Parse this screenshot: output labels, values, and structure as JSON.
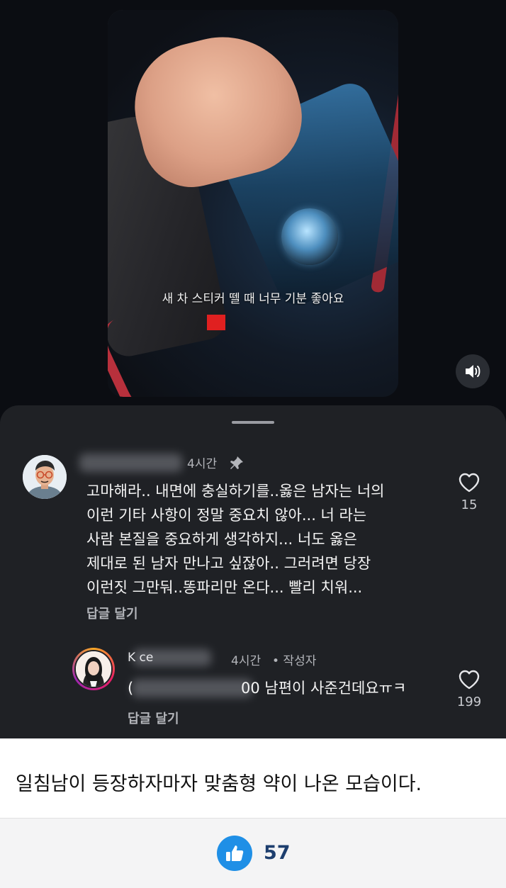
{
  "video": {
    "caption": "새 차 스티커 뗄 때 너무 기분 좋아요"
  },
  "comments": [
    {
      "author": "",
      "time": "4시간",
      "pinned": true,
      "text_lines": [
        "고마해라.. 내면에 충실하기를..옳은 남자는 너의",
        "이런 기타 사항이  정말 중요치 않아... 너 라는",
        "사람 본질을 중요하게 생각하지... 너도 옳은",
        "제대로 된 남자 만나고 싶잖아.. 그러려면 당장",
        "이런짓 그만둬..똥파리만 온다... 빨리 치워..."
      ],
      "reply_label": "답글 달기",
      "likes": "15"
    },
    {
      "author": "K          ce",
      "time": "4시간",
      "author_badge": "• 작성자",
      "text_prefix": "(",
      "text": "00 남편이 사준건데요ㅠㅋ",
      "reply_label": "답글 달기",
      "likes": "199"
    }
  ],
  "post": {
    "caption": "일침남이 등장하자마자 맞춤형 약이 나온 모습이다."
  },
  "footer": {
    "like_count": "57"
  },
  "colors": {
    "sheet_bg": "#1f2125",
    "like_button": "#1f8fe6",
    "count_text": "#1d3e6e"
  }
}
